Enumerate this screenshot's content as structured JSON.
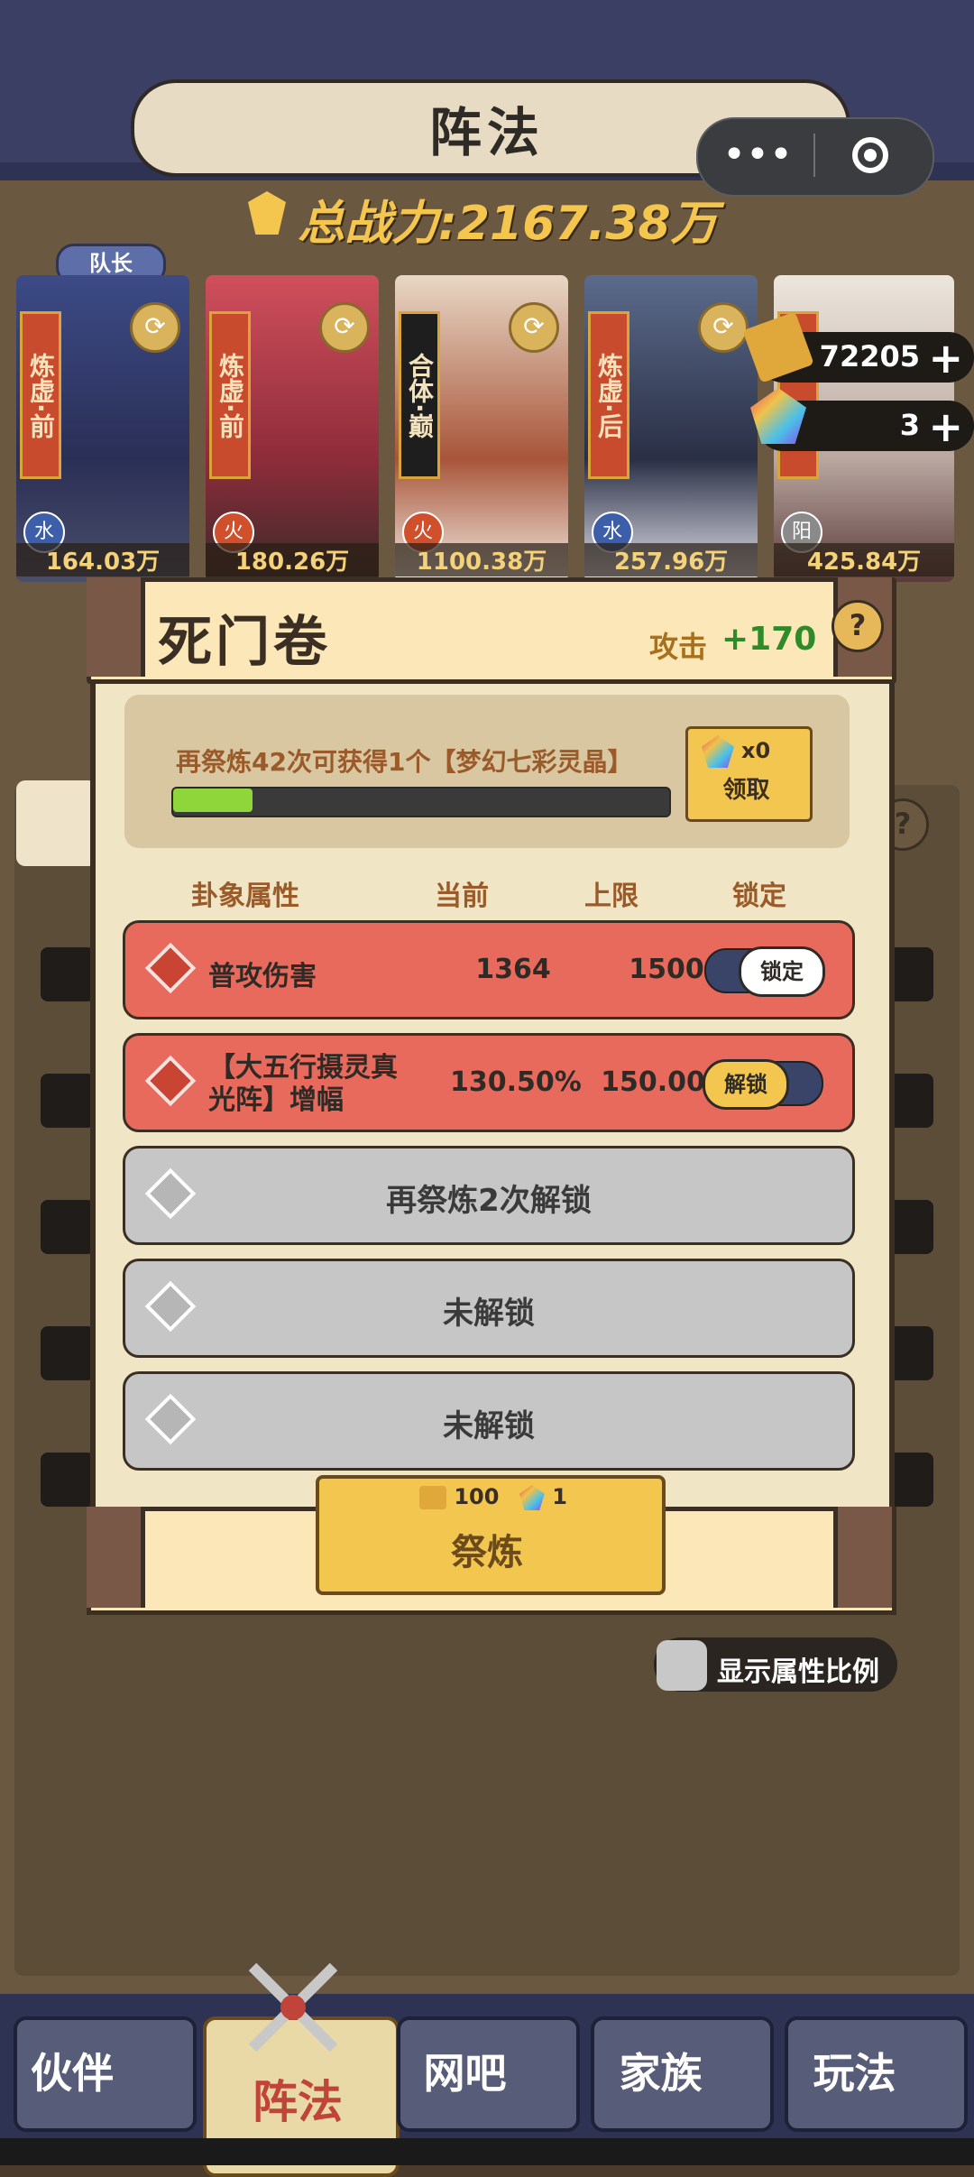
{
  "header": {
    "title": "阵法"
  },
  "capsule": {
    "more": "•••"
  },
  "power": {
    "label": "总战力:2167.38万"
  },
  "captain_tag": "队长",
  "characters": [
    {
      "rank": "炼虚·前",
      "element": "水",
      "power": "164.03万"
    },
    {
      "rank": "炼虚·前",
      "element": "火",
      "power": "180.26万"
    },
    {
      "rank": "合体·巅",
      "element": "火",
      "power": "1100.38万"
    },
    {
      "rank": "炼虚·后",
      "element": "水",
      "power": "257.96万"
    },
    {
      "rank": "",
      "element": "阳",
      "power": "425.84万"
    }
  ],
  "resources": {
    "scroll": "72205",
    "gem": "3",
    "plus": "+"
  },
  "dialog": {
    "title": "死门卷",
    "attack_label": "攻击",
    "attack_value": "+170",
    "help": "?",
    "progress_text": "再祭炼42次可获得1个【梦幻七彩灵晶】",
    "progress_fraction": 0.16,
    "claim_count": "x0",
    "claim_label": "领取",
    "columns": {
      "attr": "卦象属性",
      "current": "当前",
      "max": "上限",
      "lock": "锁定"
    },
    "rows": [
      {
        "name": "普攻伤害",
        "current": "1364",
        "max": "1500",
        "toggle": "锁定"
      },
      {
        "name": "【大五行摄灵真光阵】增幅",
        "current": "130.50%",
        "max": "150.00%",
        "toggle": "解锁"
      }
    ],
    "locked_rows": [
      "再祭炼2次解锁",
      "未解锁",
      "未解锁"
    ],
    "refine_cost_scroll": "100",
    "refine_cost_gem": "1",
    "refine_label": "祭炼"
  },
  "show_ratio": "显示属性比例",
  "side_help": "?",
  "nav": [
    "伙伴",
    "阵法",
    "网吧",
    "家族",
    "玩法"
  ],
  "colors": {
    "accent_gold": "#f3c64f",
    "row_red": "#e86a5c",
    "nav_bg": "#2e3354"
  }
}
